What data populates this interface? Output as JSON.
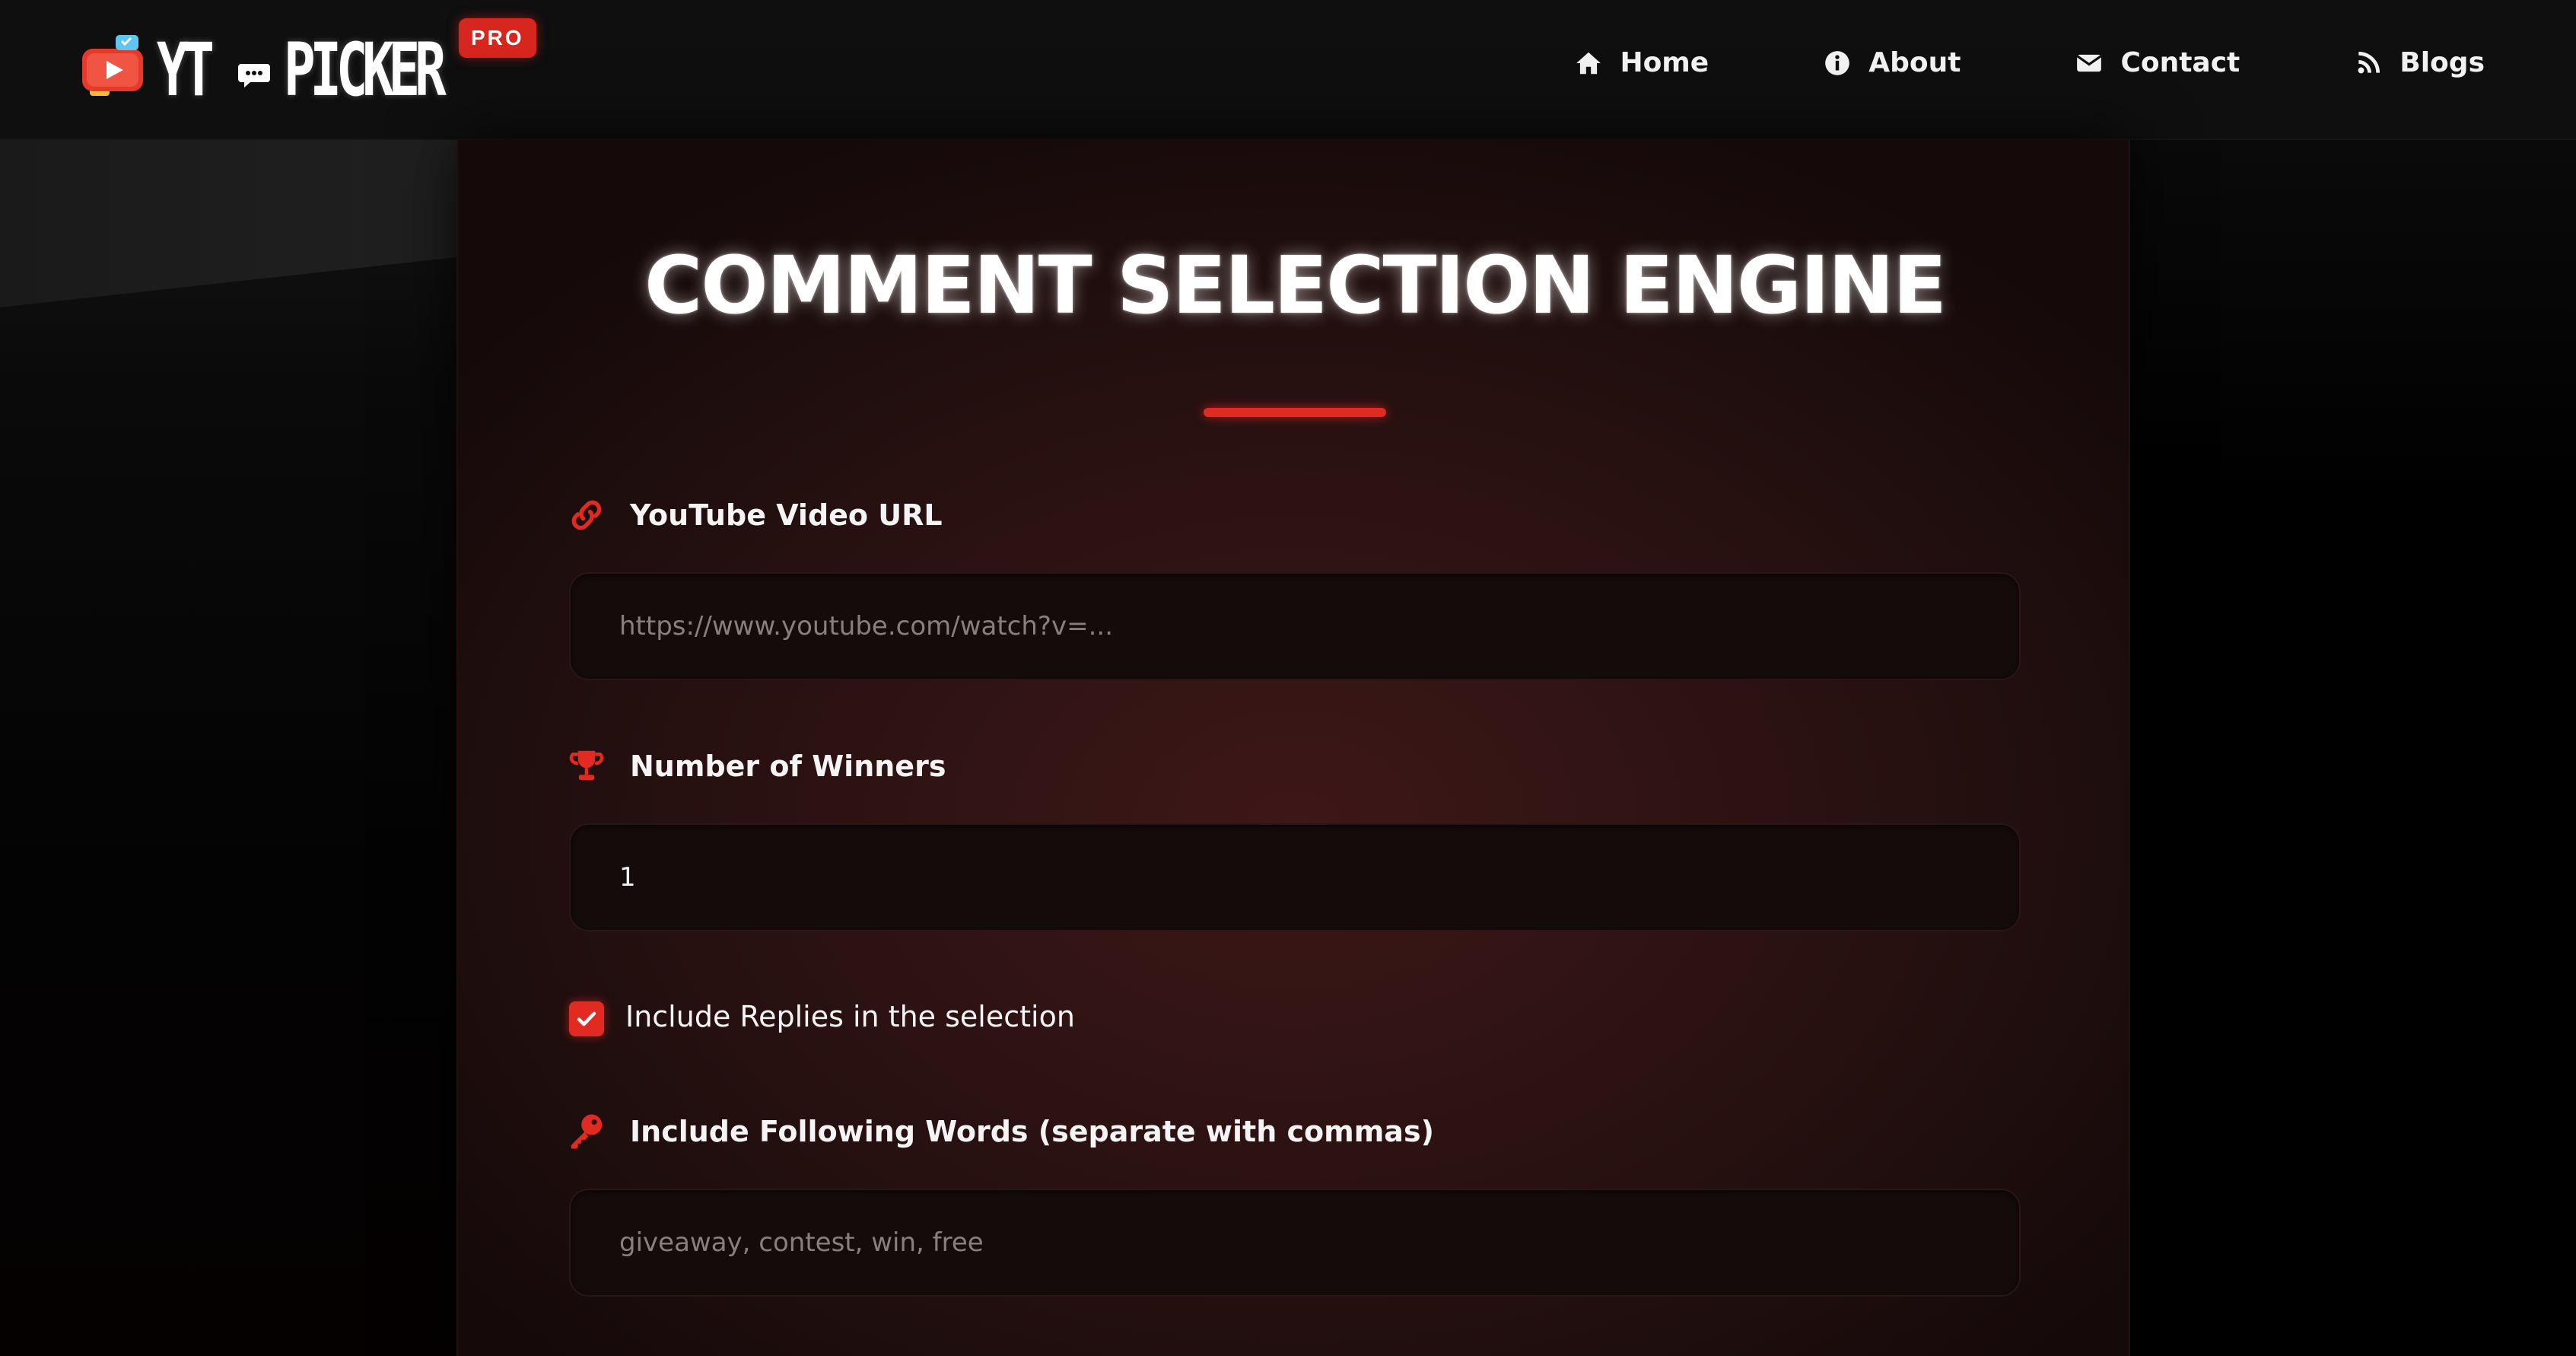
{
  "brand": {
    "name_part1": "YT",
    "name_part2": "PICKER",
    "badge": "PRO",
    "accent": "#e12a22"
  },
  "nav": {
    "items": [
      {
        "label": "Home",
        "icon": "home-icon"
      },
      {
        "label": "About",
        "icon": "info-icon"
      },
      {
        "label": "Contact",
        "icon": "envelope-icon"
      },
      {
        "label": "Blogs",
        "icon": "rss-icon"
      }
    ]
  },
  "main": {
    "title": "COMMENT SELECTION ENGINE",
    "url_field": {
      "label": "YouTube Video URL",
      "icon": "link-icon",
      "placeholder": "https://www.youtube.com/watch?v=...",
      "value": ""
    },
    "winners_field": {
      "label": "Number of Winners",
      "icon": "trophy-icon",
      "value": "1"
    },
    "replies_checkbox": {
      "label": "Include Replies in the selection",
      "checked": true
    },
    "words_field": {
      "label": "Include Following Words (separate with commas)",
      "icon": "key-icon",
      "placeholder": "giveaway, contest, win, free",
      "value": ""
    }
  }
}
